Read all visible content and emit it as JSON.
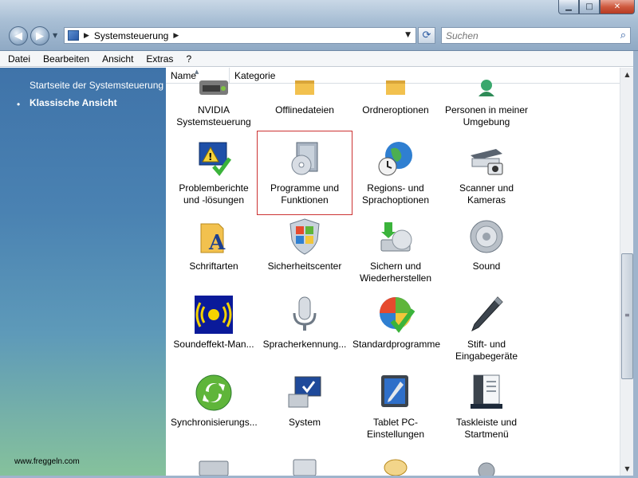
{
  "window": {
    "minimize_glyph": "▁",
    "maximize_glyph": "□",
    "close_glyph": "✕"
  },
  "navigation": {
    "back_glyph": "◀",
    "forward_glyph": "▶",
    "dropdown_glyph": "▼"
  },
  "address": {
    "separator": "▶",
    "path": "Systemsteuerung",
    "trailing_separator": "▶",
    "dropdown_glyph": "▼",
    "refresh_glyph": "⟳"
  },
  "search": {
    "placeholder": "Suchen",
    "icon_glyph": "⌕"
  },
  "menu": [
    "Datei",
    "Bearbeiten",
    "Ansicht",
    "Extras",
    "?"
  ],
  "taskpane": {
    "home_link": "Startseite der Systemsteuerung",
    "bullet": "•",
    "classic_view": "Klassische Ansicht",
    "watermark": "www.freggeln.com"
  },
  "columns": {
    "name": "Name",
    "category": "Kategorie",
    "sort_glyph": "▲"
  },
  "items": [
    {
      "label": "NVIDIA Systemsteuerung",
      "icon": "nvidia-icon"
    },
    {
      "label": "Offlinedateien",
      "icon": "offline-files-icon"
    },
    {
      "label": "Ordneroptionen",
      "icon": "folder-options-icon"
    },
    {
      "label": "Personen in meiner Umgebung",
      "icon": "people-near-me-icon"
    },
    {
      "label": "Problemberichte und -lösungen",
      "icon": "problem-reports-icon"
    },
    {
      "label": "Programme und Funktionen",
      "icon": "programs-features-icon"
    },
    {
      "label": "Regions- und Sprachoptionen",
      "icon": "regional-language-icon"
    },
    {
      "label": "Scanner und Kameras",
      "icon": "scanner-camera-icon"
    },
    {
      "label": "Schriftarten",
      "icon": "fonts-icon"
    },
    {
      "label": "Sicherheitscenter",
      "icon": "security-center-icon"
    },
    {
      "label": "Sichern und Wiederherstellen",
      "icon": "backup-restore-icon"
    },
    {
      "label": "Sound",
      "icon": "sound-icon"
    },
    {
      "label": "Soundeffekt-Man...",
      "icon": "sound-effect-manager-icon"
    },
    {
      "label": "Spracherkennung...",
      "icon": "speech-recognition-icon"
    },
    {
      "label": "Standardprogramme",
      "icon": "default-programs-icon"
    },
    {
      "label": "Stift- und Eingabegeräte",
      "icon": "pen-input-icon"
    },
    {
      "label": "Synchronisierungs...",
      "icon": "sync-center-icon"
    },
    {
      "label": "System",
      "icon": "system-icon"
    },
    {
      "label": "Tablet PC-Einstellungen",
      "icon": "tablet-pc-icon"
    },
    {
      "label": "Taskleiste und Startmenü",
      "icon": "taskbar-startmenu-icon"
    }
  ],
  "selected_item": "Programme und Funktionen",
  "scrollbar": {
    "up_glyph": "▲",
    "down_glyph": "▼",
    "grip_glyph": "≡"
  }
}
